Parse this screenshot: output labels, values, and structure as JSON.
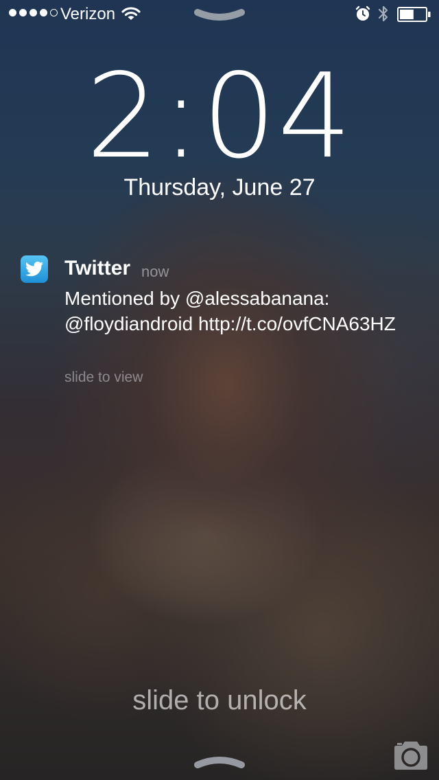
{
  "status_bar": {
    "signal_dots_filled": 4,
    "signal_dots_total": 5,
    "carrier": "Verizon",
    "icons": [
      "wifi-icon",
      "alarm-icon",
      "bluetooth-icon",
      "battery-icon"
    ],
    "battery_level": 0.55
  },
  "lock_screen": {
    "time": "2:04",
    "date": "Thursday, June 27",
    "slide_to_unlock": "slide to unlock"
  },
  "notification": {
    "app_name": "Twitter",
    "time": "now",
    "message": "Mentioned by @alessabanana: @floydiandroid http://t.co/ovfCNA63HZ",
    "hint": "slide to view",
    "app_icon": "twitter-bird-icon"
  },
  "colors": {
    "text": "#ffffff",
    "twitter_blue": "#2a9de0"
  }
}
